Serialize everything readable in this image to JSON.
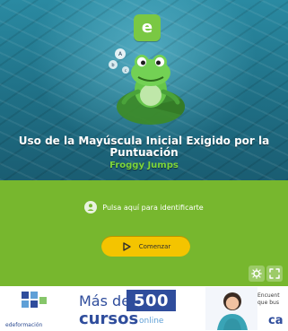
{
  "activity": {
    "logo_letter": "e",
    "title": "Uso de la Mayúscula Inicial Exigido por la Puntuación",
    "author": "Froggy Jumps"
  },
  "actions": {
    "identify_label": "Pulsa aquí para identificarte",
    "start_label": "Comenzar"
  },
  "ad": {
    "brand": "edeformación",
    "line1": "Más de",
    "number": "500",
    "line2": "cursos",
    "online": "online",
    "right_snippet": "Encuent que bus",
    "right_cta": "ca"
  },
  "icons": {
    "logo": "educaplay-logo",
    "mascot": "frog-on-lilypad",
    "user": "user-icon",
    "play": "play-icon",
    "settings": "gear-icon",
    "fullscreen": "fullscreen-icon",
    "ad_left": "grid-logo-icon",
    "ad_person": "person-photo"
  },
  "colors": {
    "water": "#1f6f85",
    "green_panel": "#77b72e",
    "logo_green": "#7ac843",
    "button_yellow": "#f4c400",
    "author_green": "#7ed63a",
    "ad_blue": "#2f4d9c"
  }
}
